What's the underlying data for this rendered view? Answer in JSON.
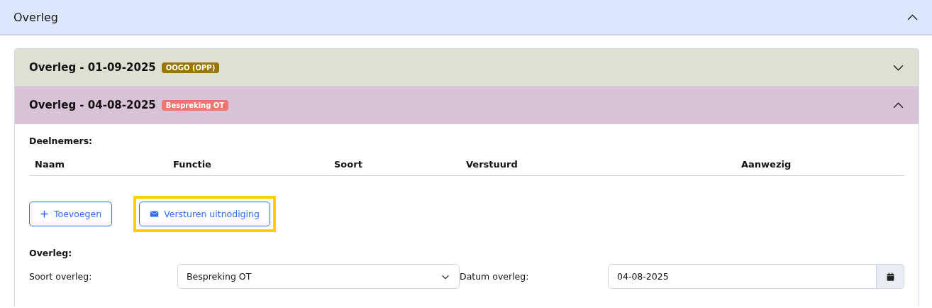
{
  "section": {
    "title": "Overleg",
    "expanded": true
  },
  "meetings": [
    {
      "title": "Overleg - 01-09-2025",
      "badge": {
        "label": "OOGO (OPP)",
        "color": "#9a7600"
      },
      "color": "#dfe0d4",
      "expanded": false
    },
    {
      "title": "Overleg - 04-08-2025",
      "badge": {
        "label": "Bespreking OT",
        "color": "#ef7570"
      },
      "color": "#d9c1d6",
      "expanded": true,
      "participants_label": "Deelnemers:",
      "columns": [
        "Naam",
        "Functie",
        "Soort",
        "Verstuurd",
        "Aanwezig"
      ],
      "buttons": [
        {
          "kind": "add",
          "label": "Toevoegen",
          "highlighted": false
        },
        {
          "kind": "mail",
          "label": "Versturen uitnodiging",
          "highlighted": true
        }
      ],
      "details_label": "Overleg:",
      "fields": [
        {
          "kind": "select",
          "label": "Soort overleg:",
          "value": "Bespreking OT"
        },
        {
          "kind": "date",
          "label": "Datum overleg:",
          "value": "04-08-2025"
        }
      ]
    }
  ]
}
